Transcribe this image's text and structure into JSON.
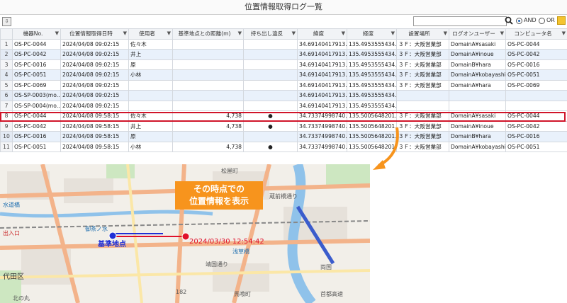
{
  "window": {
    "title": "位置情報取得ログ一覧"
  },
  "toolbar": {
    "search_value": "",
    "and_label": "AND",
    "or_label": "OR",
    "match_mode": "AND"
  },
  "table": {
    "columns": [
      "機器No.",
      "位置情報取得日時",
      "使用者",
      "基準地点との距離(m)",
      "持ち出し違反",
      "緯度",
      "経度",
      "設置場所",
      "ログオンユーザー",
      "コンピュータ名"
    ],
    "rows": [
      {
        "n": "1",
        "device": "OS-PC-0044",
        "time": "2024/04/08 09:02:15",
        "user": "佐々木",
        "dist": "",
        "viol": "",
        "lat": "34.69140417913...",
        "lng": "135.4953555434...",
        "loc": "３Ｆ：大阪営業部",
        "logon": "DomainA¥sasaki",
        "pc": "OS-PC-0044"
      },
      {
        "n": "2",
        "device": "OS-PC-0042",
        "time": "2024/04/08 09:02:15",
        "user": "井上",
        "dist": "",
        "viol": "",
        "lat": "34.69140417913...",
        "lng": "135.4953555434...",
        "loc": "３Ｆ：大阪営業部",
        "logon": "DomainA¥inoue",
        "pc": "OS-PC-0042"
      },
      {
        "n": "3",
        "device": "OS-PC-0016",
        "time": "2024/04/08 09:02:15",
        "user": "原",
        "dist": "",
        "viol": "",
        "lat": "34.69140417913...",
        "lng": "135.4953555434...",
        "loc": "３Ｆ：大阪営業部",
        "logon": "DomainB¥hara",
        "pc": "OS-PC-0016"
      },
      {
        "n": "4",
        "device": "OS-PC-0051",
        "time": "2024/04/08 09:02:15",
        "user": "小林",
        "dist": "",
        "viol": "",
        "lat": "34.69140417913...",
        "lng": "135.4953555434...",
        "loc": "３Ｆ：大阪営業部",
        "logon": "DomainA¥kobayashi",
        "pc": "OS-PC-0051"
      },
      {
        "n": "5",
        "device": "OS-PC-0069",
        "time": "2024/04/08 09:02:15",
        "user": "",
        "dist": "",
        "viol": "",
        "lat": "34.69140417913...",
        "lng": "135.4953555434...",
        "loc": "３Ｆ：大阪営業部",
        "logon": "DomainA¥hara",
        "pc": "OS-PC-0069"
      },
      {
        "n": "6",
        "device": "OS-SP-0003(mo...",
        "time": "2024/04/08 09:02:15",
        "user": "",
        "dist": "",
        "viol": "",
        "lat": "34.69140417913...",
        "lng": "135.4953555434...",
        "loc": "",
        "logon": "",
        "pc": ""
      },
      {
        "n": "7",
        "device": "OS-SP-0004(mo...",
        "time": "2024/04/08 09:02:15",
        "user": "",
        "dist": "",
        "viol": "",
        "lat": "34.69140417913...",
        "lng": "135.4953555434...",
        "loc": "",
        "logon": "",
        "pc": ""
      },
      {
        "n": "8",
        "device": "OS-PC-0044",
        "time": "2024/04/08 09:58:15",
        "user": "佐々木",
        "dist": "4,738",
        "viol": "●",
        "lat": "34.73374998740...",
        "lng": "135.5005648201...",
        "loc": "３Ｆ：大阪営業部",
        "logon": "DomainA¥sasaki",
        "pc": "OS-PC-0044"
      },
      {
        "n": "9",
        "device": "OS-PC-0042",
        "time": "2024/04/08 09:58:15",
        "user": "井上",
        "dist": "4,738",
        "viol": "●",
        "lat": "34.73374998740...",
        "lng": "135.5005648201...",
        "loc": "３Ｆ：大阪営業部",
        "logon": "DomainA¥inoue",
        "pc": "OS-PC-0042"
      },
      {
        "n": "10",
        "device": "OS-PC-0016",
        "time": "2024/04/08 09:58:15",
        "user": "原",
        "dist": "",
        "viol": "",
        "lat": "34.73374998740...",
        "lng": "135.5005648201...",
        "loc": "３Ｆ：大阪営業部",
        "logon": "DomainB¥hara",
        "pc": "OS-PC-0016"
      },
      {
        "n": "11",
        "device": "OS-PC-0051",
        "time": "2024/04/08 09:58:15",
        "user": "小林",
        "dist": "4,738",
        "viol": "●",
        "lat": "34.73374998740...",
        "lng": "135.5005648201...",
        "loc": "３Ｆ：大阪営業部",
        "logon": "DomainA¥kobayashi",
        "pc": "OS-PC-0051"
      }
    ],
    "selected_row": 8
  },
  "callout": {
    "line1": "その時点での",
    "line2": "位置情報を表示"
  },
  "map": {
    "base_label": "基準地点",
    "timestamp": "2024/03/30 12:54:42",
    "labels": [
      "松屋町",
      "水道橋",
      "出入口",
      "代田区",
      "御茶ノ水",
      "浅草橋",
      "馬喰町",
      "両国",
      "靖国通り",
      "蔵前橋通り",
      "首都高速",
      "北の丸",
      "182"
    ],
    "colors": {
      "base_marker": "#1f2fd6",
      "device_marker": "#e0102a",
      "route": "#e0102a"
    }
  }
}
